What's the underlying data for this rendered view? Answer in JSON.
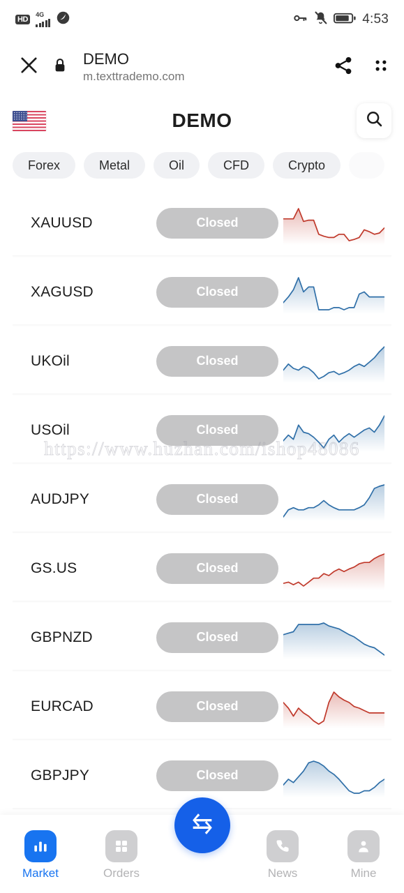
{
  "statusbar": {
    "hd_label": "HD",
    "network_label": "4G",
    "time": "4:53",
    "icons": [
      "hd-badge",
      "signal-bars",
      "data-saver-icon",
      "vpn-key-icon",
      "notifications-muted-icon",
      "battery-icon"
    ]
  },
  "browser": {
    "title": "DEMO",
    "url": "m.texttrademo.com",
    "close_icon": "close-icon",
    "lock_icon": "lock-icon",
    "share_icon": "share-icon",
    "menu_icon": "grid-menu-icon"
  },
  "app_header": {
    "title": "DEMO",
    "flag": "us-flag-icon",
    "search_icon": "search-icon"
  },
  "categories": [
    {
      "label": "Forex",
      "active": false
    },
    {
      "label": "Metal",
      "active": false
    },
    {
      "label": "Oil",
      "active": false
    },
    {
      "label": "CFD",
      "active": false
    },
    {
      "label": "Crypto",
      "active": false
    }
  ],
  "instruments": [
    {
      "symbol": "XAUUSD",
      "status": "Closed",
      "trend": "down",
      "color": "#c0392b"
    },
    {
      "symbol": "XAGUSD",
      "status": "Closed",
      "trend": "down",
      "color": "#2f6fa8"
    },
    {
      "symbol": "UKOil",
      "status": "Closed",
      "trend": "up",
      "color": "#2f6fa8"
    },
    {
      "symbol": "USOil",
      "status": "Closed",
      "trend": "up",
      "color": "#2f6fa8"
    },
    {
      "symbol": "AUDJPY",
      "status": "Closed",
      "trend": "up",
      "color": "#2f6fa8"
    },
    {
      "symbol": "GS.US",
      "status": "Closed",
      "trend": "up",
      "color": "#c0392b"
    },
    {
      "symbol": "GBPNZD",
      "status": "Closed",
      "trend": "down",
      "color": "#2f6fa8"
    },
    {
      "symbol": "EURCAD",
      "status": "Closed",
      "trend": "down",
      "color": "#c0392b"
    },
    {
      "symbol": "GBPJPY",
      "status": "Closed",
      "trend": "down",
      "color": "#2f6fa8"
    }
  ],
  "chart_data": {
    "type": "line",
    "title": "Instrument sparklines",
    "xlabel": "",
    "ylabel": "",
    "grid": false,
    "legend": "none",
    "series": [
      {
        "name": "XAUUSD",
        "color": "#c0392b",
        "values": [
          62,
          62,
          62,
          78,
          58,
          60,
          60,
          38,
          35,
          33,
          33,
          38,
          38,
          28,
          30,
          33,
          45,
          42,
          38,
          40,
          48
        ]
      },
      {
        "name": "XAGUSD",
        "color": "#2f6fa8",
        "values": [
          40,
          48,
          58,
          75,
          55,
          62,
          62,
          30,
          30,
          30,
          33,
          33,
          30,
          33,
          33,
          52,
          55,
          48,
          48,
          48,
          48
        ]
      },
      {
        "name": "UKOil",
        "color": "#2f6fa8",
        "values": [
          42,
          52,
          45,
          42,
          48,
          45,
          38,
          28,
          32,
          38,
          40,
          35,
          38,
          42,
          48,
          52,
          48,
          55,
          62,
          72,
          80
        ]
      },
      {
        "name": "USOil",
        "color": "#2f6fa8",
        "values": [
          40,
          48,
          42,
          62,
          52,
          50,
          45,
          38,
          30,
          42,
          48,
          38,
          45,
          50,
          45,
          50,
          55,
          58,
          52,
          62,
          75
        ]
      },
      {
        "name": "AUDJPY",
        "color": "#2f6fa8",
        "values": [
          35,
          45,
          48,
          45,
          45,
          48,
          48,
          52,
          58,
          52,
          48,
          45,
          45,
          45,
          45,
          48,
          52,
          62,
          75,
          78,
          80
        ]
      },
      {
        "name": "GS.US",
        "color": "#c0392b",
        "values": [
          30,
          32,
          28,
          32,
          26,
          32,
          38,
          38,
          45,
          42,
          48,
          52,
          48,
          52,
          55,
          60,
          62,
          62,
          68,
          72,
          75
        ]
      },
      {
        "name": "GBPNZD",
        "color": "#2f6fa8",
        "values": [
          58,
          60,
          62,
          72,
          72,
          72,
          72,
          72,
          74,
          70,
          68,
          66,
          62,
          58,
          55,
          50,
          45,
          42,
          40,
          35,
          30
        ]
      },
      {
        "name": "EURCAD",
        "color": "#c0392b",
        "values": [
          55,
          48,
          38,
          48,
          42,
          38,
          32,
          28,
          32,
          55,
          68,
          62,
          58,
          55,
          50,
          48,
          45,
          42,
          42,
          42,
          42
        ]
      },
      {
        "name": "GBPJPY",
        "color": "#2f6fa8",
        "values": [
          45,
          52,
          48,
          55,
          62,
          72,
          74,
          72,
          68,
          62,
          58,
          52,
          45,
          38,
          35,
          35,
          38,
          38,
          42,
          48,
          52
        ]
      }
    ]
  },
  "watermark": {
    "text": "https://www.huzhan.com/ishop48086"
  },
  "bottomnav": {
    "items": [
      {
        "label": "Market",
        "icon": "bar-chart-icon",
        "active": true
      },
      {
        "label": "Orders",
        "icon": "grid-icon",
        "active": false
      },
      {
        "label": "News",
        "icon": "phone-icon",
        "active": false
      },
      {
        "label": "Mine",
        "icon": "person-icon",
        "active": false
      }
    ],
    "fab": {
      "icon": "exchange-arrows-icon"
    }
  },
  "colors": {
    "accent": "#1874f0",
    "fab": "#1560e8",
    "up_line": "#2f6fa8",
    "down_line": "#c0392b",
    "pill_bg": "#c5c5c6",
    "chip_bg": "#f0f1f4"
  }
}
